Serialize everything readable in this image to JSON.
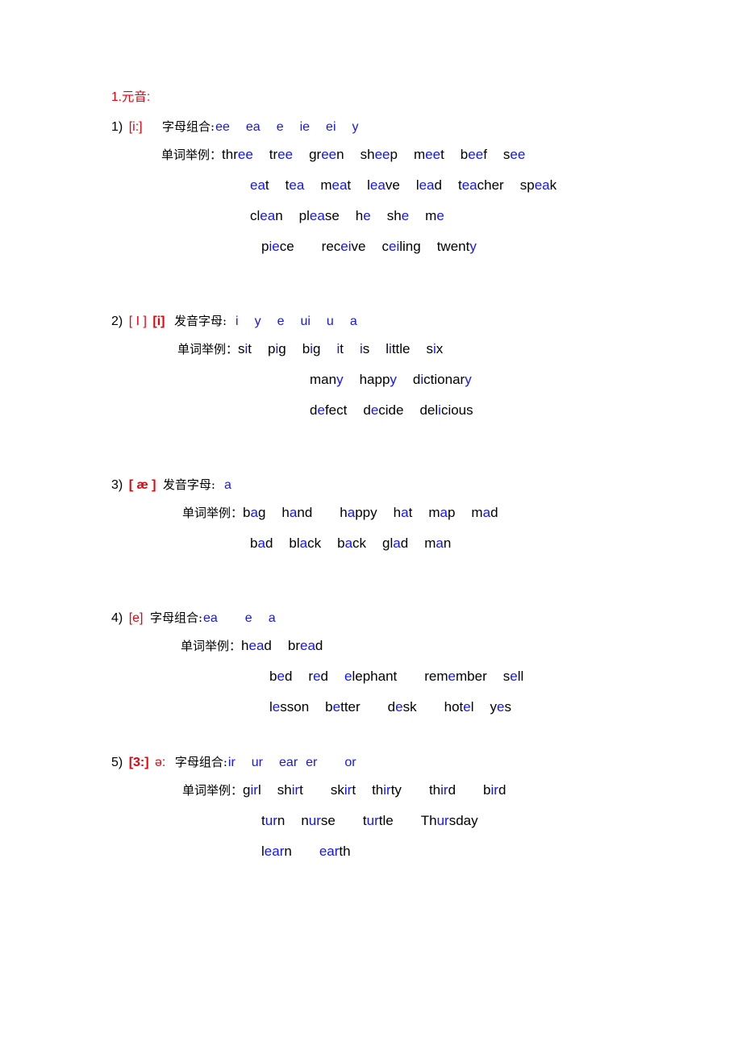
{
  "document": {
    "section_title": "1.元音:",
    "label_letter_combination": "字母组合:",
    "label_pronouncing_letters": "发音字母:",
    "label_word_examples": "单词举例：",
    "colors": {
      "accent_red": "#e8000b",
      "highlight_blue": "#1414ff",
      "text_black": "#000000"
    }
  },
  "entries": [
    {
      "index": "1)",
      "ipa": "[i:]",
      "ipa_bold": false,
      "ipa_extra": "",
      "combo_label": "字母组合:",
      "combos": [
        "ee",
        "ea",
        "e",
        "ie",
        "ei",
        "y"
      ],
      "rows": [
        {
          "label": "单词举例：",
          "words": [
            {
              "text": "three",
              "pre": "thr",
              "hl": "ee",
              "post": ""
            },
            {
              "text": "tree",
              "pre": "tr",
              "hl": "ee",
              "post": ""
            },
            {
              "text": "green",
              "pre": "gr",
              "hl": "ee",
              "post": "n"
            },
            {
              "text": "sheep",
              "pre": "sh",
              "hl": "ee",
              "post": "p"
            },
            {
              "text": "meet",
              "pre": "m",
              "hl": "ee",
              "post": "t"
            },
            {
              "text": "beef",
              "pre": "b",
              "hl": "ee",
              "post": "f"
            },
            {
              "text": "see",
              "pre": "s",
              "hl": "ee",
              "post": ""
            }
          ]
        },
        {
          "label": "",
          "words": [
            {
              "text": "eat",
              "pre": "",
              "hl": "ea",
              "post": "t"
            },
            {
              "text": "tea",
              "pre": "t",
              "hl": "ea",
              "post": ""
            },
            {
              "text": "meat",
              "pre": "m",
              "hl": "ea",
              "post": "t"
            },
            {
              "text": "leave",
              "pre": "l",
              "hl": "ea",
              "post": "ve"
            },
            {
              "text": "lead",
              "pre": "l",
              "hl": "ea",
              "post": "d"
            },
            {
              "text": "teacher",
              "pre": "t",
              "hl": "ea",
              "post": "cher"
            },
            {
              "text": "speak",
              "pre": "sp",
              "hl": "ea",
              "post": "k"
            }
          ]
        },
        {
          "label": "",
          "words": [
            {
              "text": "clean",
              "pre": "cl",
              "hl": "ea",
              "post": "n"
            },
            {
              "text": "please",
              "pre": "pl",
              "hl": "ea",
              "post": "se"
            },
            {
              "text": "he",
              "pre": "h",
              "hl": "e",
              "post": ""
            },
            {
              "text": "she",
              "pre": "sh",
              "hl": "e",
              "post": ""
            },
            {
              "text": "me",
              "pre": "m",
              "hl": "e",
              "post": ""
            }
          ]
        },
        {
          "label": "",
          "words": [
            {
              "text": "piece",
              "pre": "p",
              "hl": "ie",
              "post": "ce"
            },
            {
              "text": "receive",
              "pre": "rec",
              "hl": "ei",
              "post": "ve"
            },
            {
              "text": "ceiling",
              "pre": "c",
              "hl": "ei",
              "post": "ling"
            },
            {
              "text": "twenty",
              "pre": "twent",
              "hl": "y",
              "post": ""
            }
          ]
        }
      ]
    },
    {
      "index": "2)",
      "ipa": "[ I ]",
      "ipa_bold": false,
      "ipa_extra": "[i]",
      "combo_label": "发音字母:",
      "combos": [
        "i",
        "y",
        "e",
        "ui",
        "u",
        "a"
      ],
      "rows": [
        {
          "label": "单词举例：",
          "words": [
            {
              "text": "sit",
              "pre": "s",
              "hl": "i",
              "post": "t"
            },
            {
              "text": "pig",
              "pre": "p",
              "hl": "i",
              "post": "g"
            },
            {
              "text": "big",
              "pre": "b",
              "hl": "i",
              "post": "g"
            },
            {
              "text": "it",
              "pre": "",
              "hl": "i",
              "post": "t"
            },
            {
              "text": "is",
              "pre": "",
              "hl": "i",
              "post": "s"
            },
            {
              "text": "little",
              "pre": "l",
              "hl": "i",
              "post": "ttle"
            },
            {
              "text": "six",
              "pre": "s",
              "hl": "i",
              "post": "x"
            }
          ]
        },
        {
          "label": "",
          "words": [
            {
              "text": "many",
              "pre": "man",
              "hl": "y",
              "post": ""
            },
            {
              "text": "happy",
              "pre": "happ",
              "hl": "y",
              "post": ""
            },
            {
              "text": "dictionary",
              "pre": "d",
              "hl": "i",
              "post": "ctionar",
              "hl2": "y"
            }
          ]
        },
        {
          "label": "",
          "words": [
            {
              "text": "defect",
              "pre": "d",
              "hl": "e",
              "post": "fect"
            },
            {
              "text": "decide",
              "pre": "d",
              "hl": "e",
              "post": "cide"
            },
            {
              "text": "delicious",
              "pre": "del",
              "hl": "i",
              "post": "cious"
            }
          ]
        }
      ]
    },
    {
      "index": "3)",
      "ipa": "[ æ ]",
      "ipa_bold": true,
      "ipa_extra": "",
      "combo_label": "发音字母:",
      "combos": [
        "a"
      ],
      "rows": [
        {
          "label": "单词举例：",
          "words": [
            {
              "text": "bag",
              "pre": "b",
              "hl": "a",
              "post": "g"
            },
            {
              "text": "hand",
              "pre": "h",
              "hl": "a",
              "post": "nd"
            },
            {
              "text": "happy",
              "pre": "h",
              "hl": "a",
              "post": "ppy"
            },
            {
              "text": "hat",
              "pre": "h",
              "hl": "a",
              "post": "t"
            },
            {
              "text": "map",
              "pre": "m",
              "hl": "a",
              "post": "p"
            },
            {
              "text": "mad",
              "pre": "m",
              "hl": "a",
              "post": "d"
            }
          ]
        },
        {
          "label": "",
          "words": [
            {
              "text": "bad",
              "pre": "b",
              "hl": "a",
              "post": "d"
            },
            {
              "text": "black",
              "pre": "bl",
              "hl": "a",
              "post": "ck"
            },
            {
              "text": "back",
              "pre": "b",
              "hl": "a",
              "post": "ck"
            },
            {
              "text": "glad",
              "pre": "gl",
              "hl": "a",
              "post": "d"
            },
            {
              "text": "man",
              "pre": "m",
              "hl": "a",
              "post": "n"
            }
          ]
        }
      ]
    },
    {
      "index": "4)",
      "ipa": "[e]",
      "ipa_bold": false,
      "ipa_extra": "",
      "combo_label": "字母组合:",
      "combos": [
        "ea",
        "e",
        "a"
      ],
      "rows": [
        {
          "label": "单词举例：",
          "words": [
            {
              "text": "head",
              "pre": "h",
              "hl": "ea",
              "post": "d"
            },
            {
              "text": "bread",
              "pre": "br",
              "hl": "ea",
              "post": "d"
            }
          ]
        },
        {
          "label": "",
          "words": [
            {
              "text": "bed",
              "pre": "b",
              "hl": "e",
              "post": "d"
            },
            {
              "text": "red",
              "pre": "r",
              "hl": "e",
              "post": "d"
            },
            {
              "text": "elephant",
              "pre": "",
              "hl": "e",
              "post": "lephant"
            },
            {
              "text": "remember",
              "pre": "rem",
              "hl": "e",
              "post": "mber"
            },
            {
              "text": "sell",
              "pre": "s",
              "hl": "e",
              "post": "ll"
            }
          ]
        },
        {
          "label": "",
          "words": [
            {
              "text": "lesson",
              "pre": "l",
              "hl": "e",
              "post": "sson"
            },
            {
              "text": "better",
              "pre": "b",
              "hl": "e",
              "post": "tter"
            },
            {
              "text": "desk",
              "pre": "d",
              "hl": "e",
              "post": "sk"
            },
            {
              "text": "hotel",
              "pre": "hot",
              "hl": "e",
              "post": "l"
            },
            {
              "text": "yes",
              "pre": "y",
              "hl": "e",
              "post": "s"
            }
          ]
        }
      ]
    },
    {
      "index": "5)",
      "ipa": "[3:]",
      "ipa_bold": true,
      "ipa_extra": "ə:",
      "combo_label": "字母组合:",
      "combos": [
        "ir",
        "ur",
        "ear",
        "er",
        "or"
      ],
      "rows": [
        {
          "label": "单词举例：",
          "words": [
            {
              "text": "girl",
              "pre": "g",
              "hl": "ir",
              "post": "l"
            },
            {
              "text": "shirt",
              "pre": "sh",
              "hl": "ir",
              "post": "t"
            },
            {
              "text": "skirt",
              "pre": "sk",
              "hl": "ir",
              "post": "t"
            },
            {
              "text": "thirty",
              "pre": "th",
              "hl": "ir",
              "post": "ty"
            },
            {
              "text": "third",
              "pre": "th",
              "hl": "ir",
              "post": "d"
            },
            {
              "text": "bird",
              "pre": "b",
              "hl": "ir",
              "post": "d"
            }
          ]
        },
        {
          "label": "",
          "words": [
            {
              "text": "turn",
              "pre": "t",
              "hl": "ur",
              "post": "n"
            },
            {
              "text": "nurse",
              "pre": "n",
              "hl": "ur",
              "post": "se"
            },
            {
              "text": "turtle",
              "pre": "t",
              "hl": "ur",
              "post": "tle"
            },
            {
              "text": "Thursday",
              "pre": "Th",
              "hl": "ur",
              "post": "sday"
            }
          ]
        },
        {
          "label": "",
          "words": [
            {
              "text": "learn",
              "pre": "l",
              "hl": "ear",
              "post": "n"
            },
            {
              "text": "earth",
              "pre": "",
              "hl": "ear",
              "post": "th"
            }
          ]
        }
      ]
    }
  ]
}
